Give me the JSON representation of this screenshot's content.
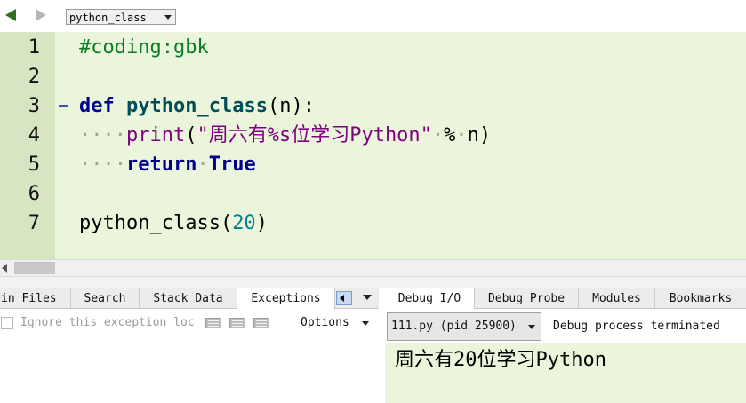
{
  "toolbar": {
    "back_icon": "back-arrow-icon",
    "forward_icon": "forward-arrow-icon",
    "function_select": "python_class"
  },
  "editor": {
    "lines": [
      {
        "num": "1",
        "tokens": [
          {
            "t": "#coding:gbk",
            "c": "cmt"
          }
        ]
      },
      {
        "num": "2",
        "tokens": []
      },
      {
        "num": "3",
        "tokens": [
          {
            "t": "def",
            "c": "kw"
          },
          {
            "t": " ",
            "c": "ws"
          },
          {
            "t": "python_class",
            "c": "fn"
          },
          {
            "t": "(n):",
            "c": "plain"
          }
        ]
      },
      {
        "num": "4",
        "tokens": [
          {
            "t": "····",
            "c": "ws"
          },
          {
            "t": "print",
            "c": "str"
          },
          {
            "t": "(",
            "c": "plain"
          },
          {
            "t": "\"周六有%s位学习Python\"",
            "c": "str"
          },
          {
            "t": "·",
            "c": "ws"
          },
          {
            "t": "%",
            "c": "plain"
          },
          {
            "t": "·",
            "c": "ws"
          },
          {
            "t": "n)",
            "c": "plain"
          }
        ]
      },
      {
        "num": "5",
        "tokens": [
          {
            "t": "····",
            "c": "ws"
          },
          {
            "t": "return",
            "c": "kw"
          },
          {
            "t": "·",
            "c": "ws"
          },
          {
            "t": "True",
            "c": "kw"
          }
        ]
      },
      {
        "num": "6",
        "tokens": []
      },
      {
        "num": "7",
        "tokens": [
          {
            "t": "python_class(",
            "c": "plain"
          },
          {
            "t": "20",
            "c": "num"
          },
          {
            "t": ")",
            "c": "plain"
          }
        ]
      }
    ]
  },
  "left_panel": {
    "tabs": [
      "in Files",
      "Search",
      "Stack Data",
      "Exceptions"
    ],
    "active_tab": "Exceptions",
    "ignore_label": "Ignore this exception loc",
    "options_label": "Options"
  },
  "right_panel": {
    "tabs": [
      "Debug I/O",
      "Debug Probe",
      "Modules",
      "Bookmarks"
    ],
    "active_tab": "Debug I/O",
    "process_select": "111.py (pid 25900)",
    "status": "Debug process terminated",
    "output": "周六有20位学习Python"
  }
}
